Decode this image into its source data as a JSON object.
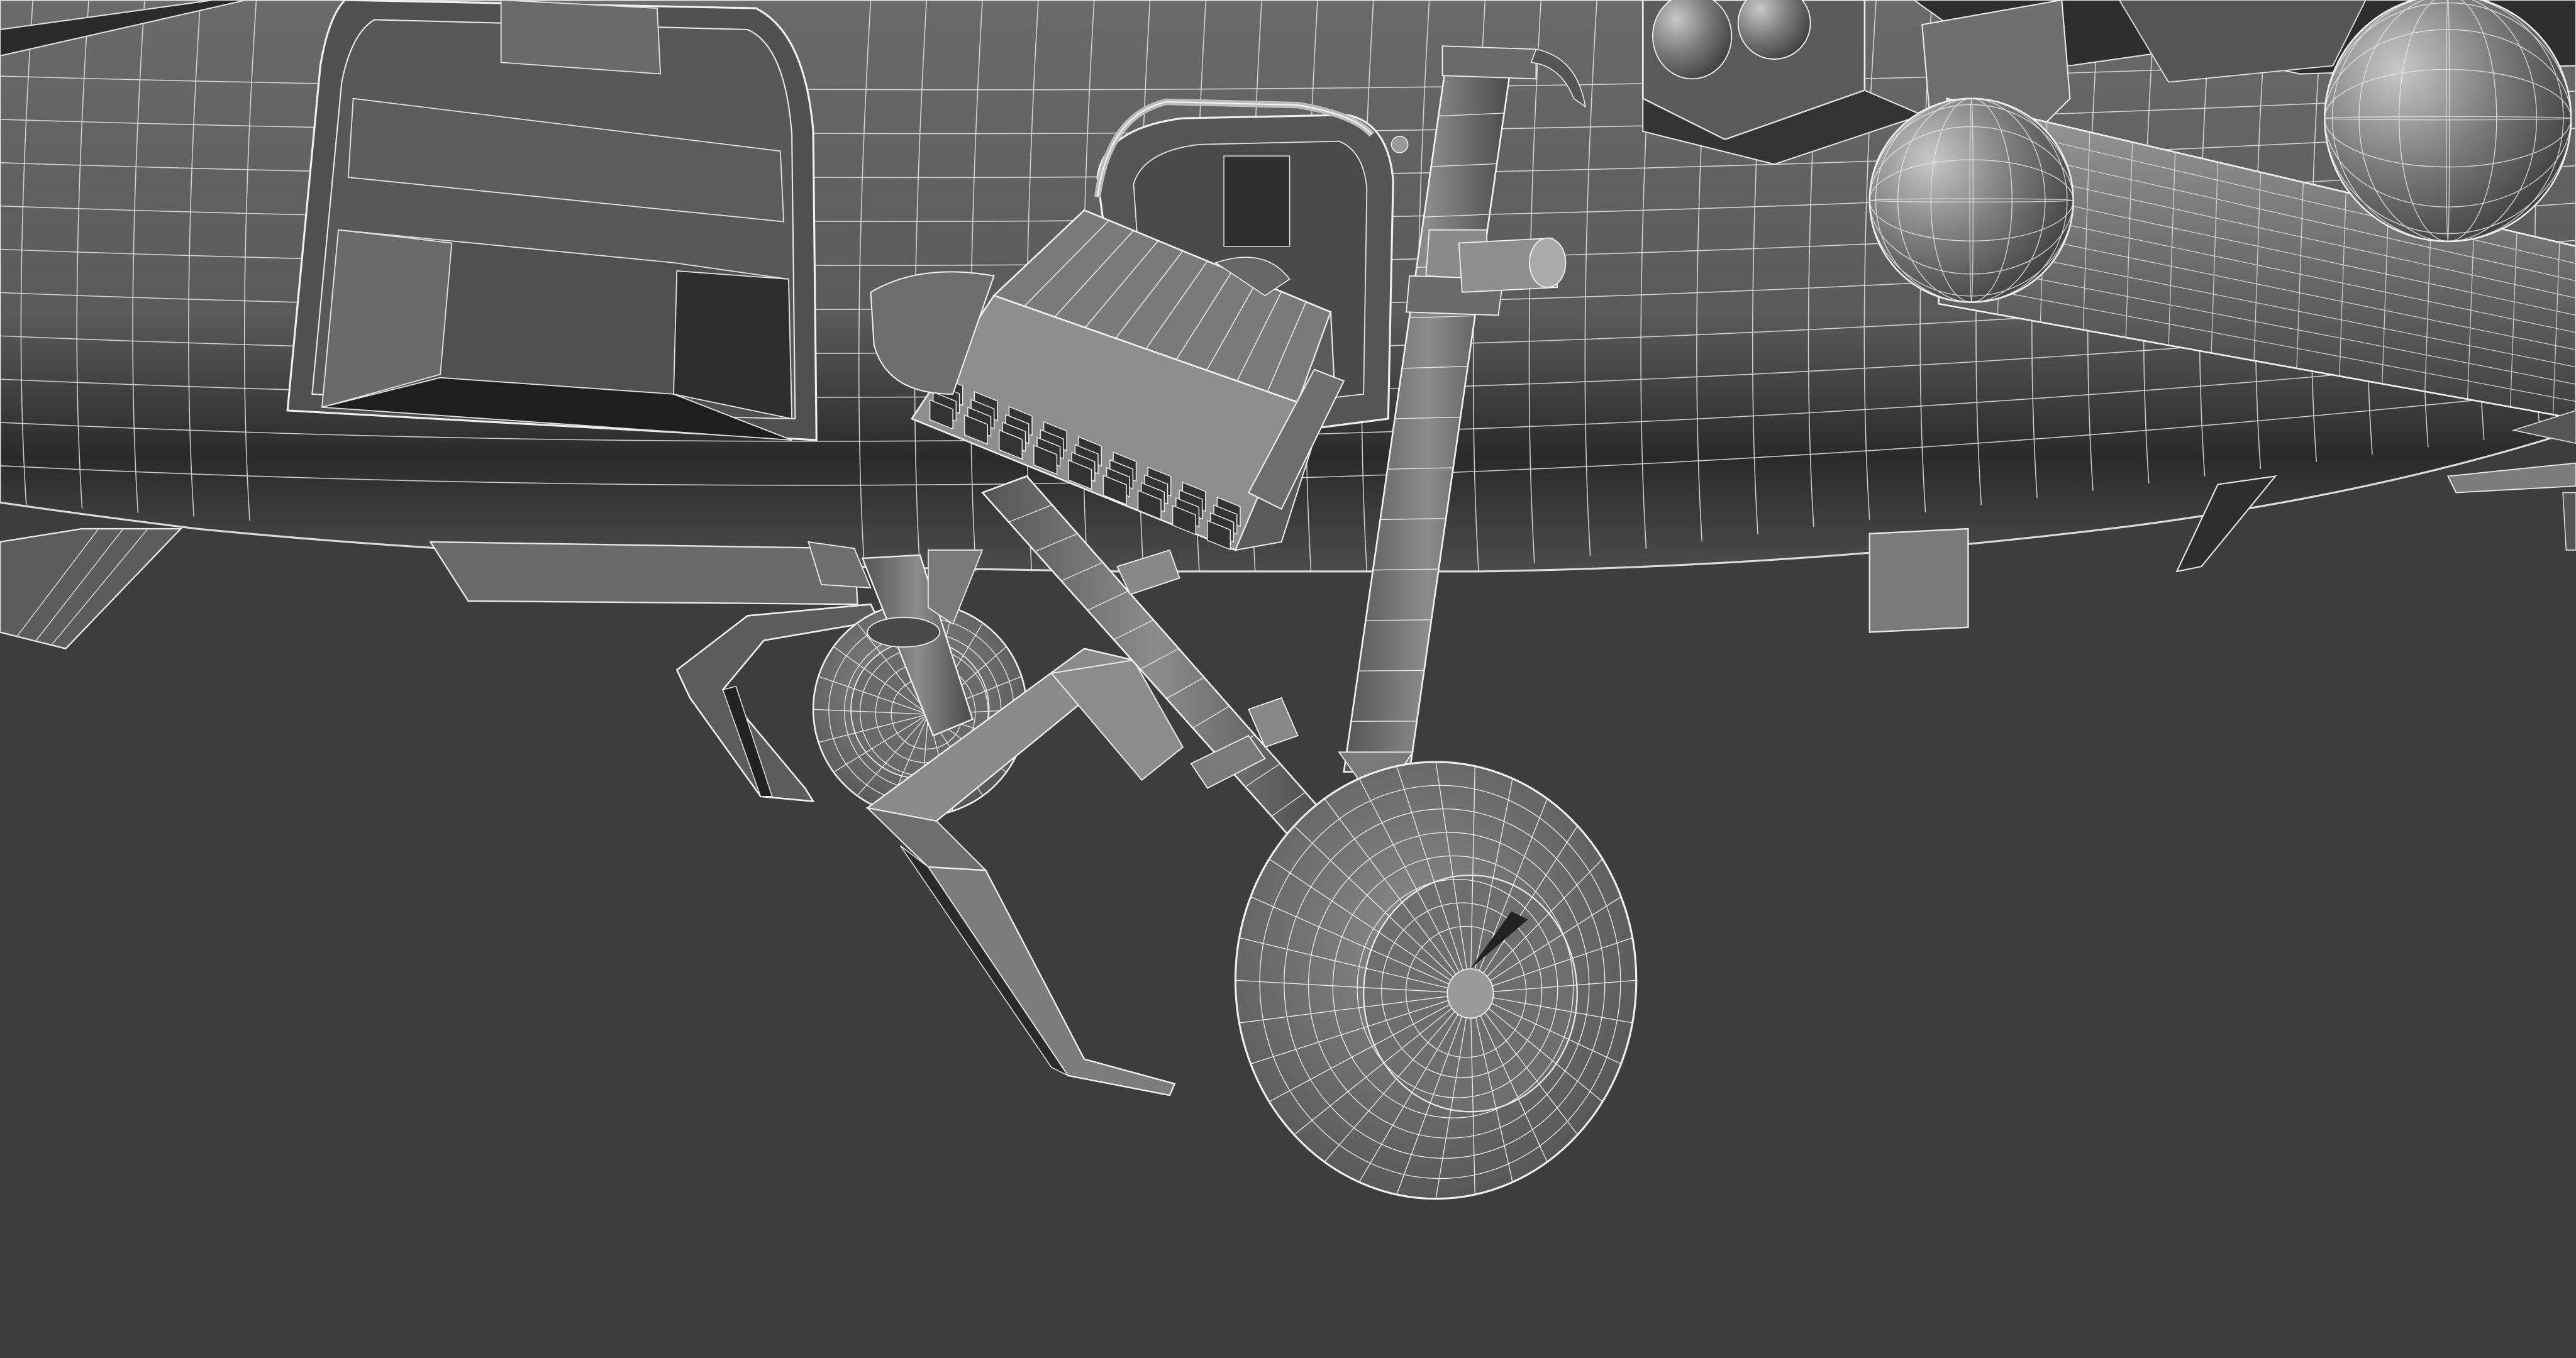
{
  "viewport": {
    "background_color": "#3d3d3d",
    "render_mode": "wireframe-on-shaded"
  },
  "model": {
    "subject": "helicopter-underside",
    "colors": {
      "surface_light": "#8e8e8e",
      "surface_mid": "#6c6c6c",
      "surface_dark": "#4a4a4a",
      "shadow": "#1e1e1e",
      "wire": "#f2f2f2"
    }
  }
}
